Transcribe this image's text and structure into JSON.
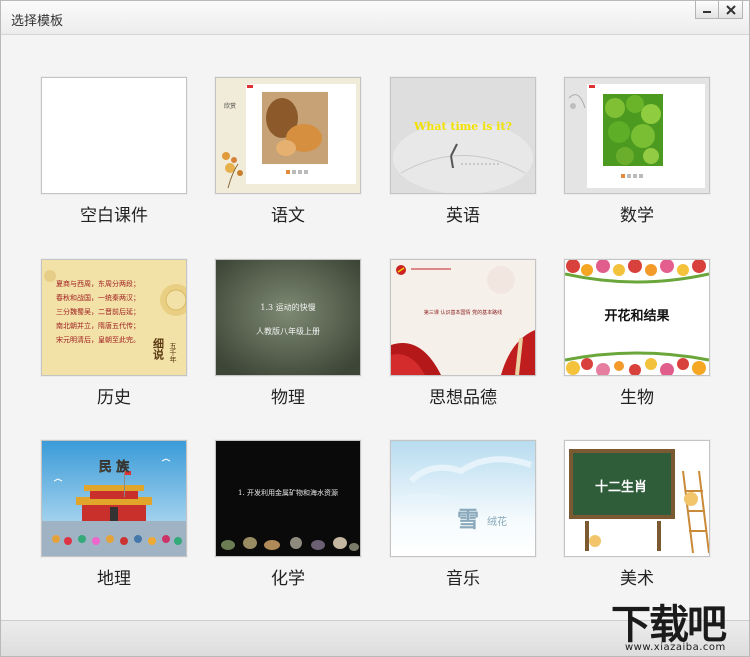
{
  "window": {
    "title": "选择模板"
  },
  "templates": [
    {
      "label": "空白课件"
    },
    {
      "label": "语文",
      "thumb_text": "欣赏"
    },
    {
      "label": "英语",
      "thumb_text": "What time is it?"
    },
    {
      "label": "数学"
    },
    {
      "label": "历史",
      "thumb_side": "细说",
      "thumb_side2": "五千年",
      "poem": [
        "夏商与西周，东周分两段；",
        "春秋和战国，一统秦两汉；",
        "三分魏蜀吴，二晋前后延；",
        "南北朝并立，隋唐五代传；",
        "宋元明清后，皇朝至此完。"
      ]
    },
    {
      "label": "物理",
      "thumb_line1": "1.3  运动的快慢",
      "thumb_line2": "人教版八年级上册"
    },
    {
      "label": "思想品德",
      "thumb_text": "第三课 认识基本国情 党的基本路线"
    },
    {
      "label": "生物",
      "thumb_text": "开花和结果"
    },
    {
      "label": "地理",
      "thumb_text": "民 族"
    },
    {
      "label": "化学",
      "thumb_text": "1.  开发利用金属矿物和海水资源"
    },
    {
      "label": "音乐",
      "thumb_text": "雪",
      "thumb_text2": "绒花"
    },
    {
      "label": "美术",
      "thumb_text": "十二生肖"
    }
  ],
  "watermark": {
    "text": "下载吧",
    "url": "www.xiazaiba.com"
  }
}
